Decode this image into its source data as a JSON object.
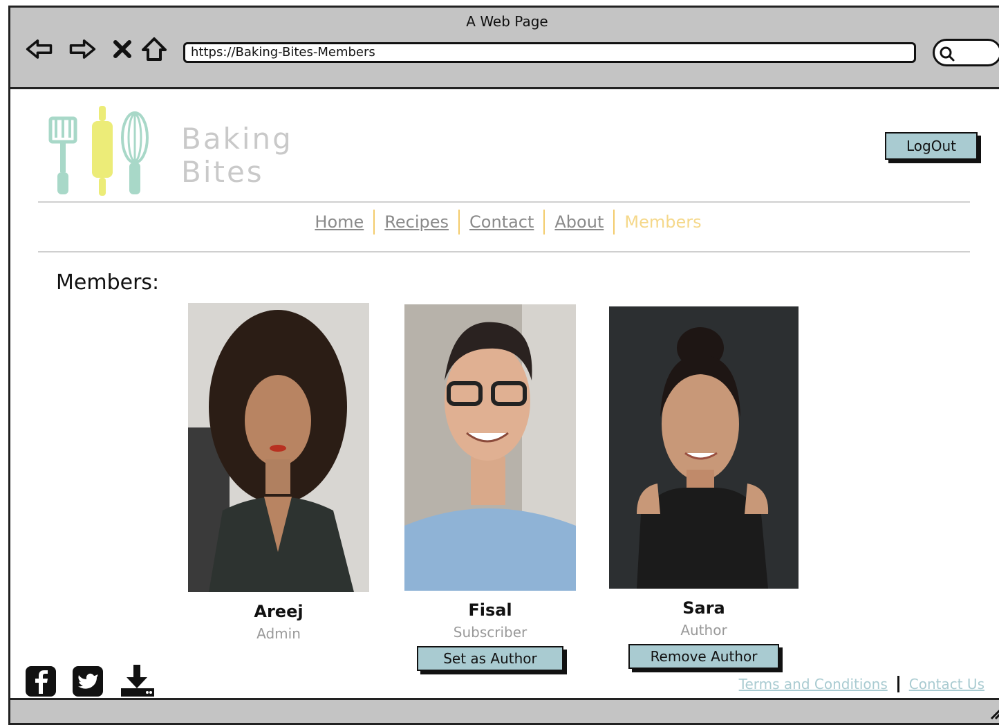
{
  "browser": {
    "title": "A Web Page",
    "url": "https://Baking-Bites-Members"
  },
  "header": {
    "logo_line1": "Baking",
    "logo_line2": "Bites",
    "logout_label": "LogOut"
  },
  "nav": [
    {
      "label": "Home"
    },
    {
      "label": "Recipes"
    },
    {
      "label": "Contact"
    },
    {
      "label": "About"
    },
    {
      "label": "Members"
    }
  ],
  "page_title": "Members:",
  "members": [
    {
      "name": "Areej",
      "role": "Admin"
    },
    {
      "name": "Fisal",
      "role": "Subscriber",
      "action": "Set as Author"
    },
    {
      "name": "Sara",
      "role": "Author",
      "action": "Remove Author"
    }
  ],
  "footer": {
    "links": [
      "Terms and Conditions",
      "Contact Us"
    ],
    "social_icons": [
      "facebook-icon",
      "twitter-icon",
      "download-icon"
    ]
  },
  "colors": {
    "button_bg": "#a9cbd1",
    "nav_active": "#f5d88a",
    "nav_divider": "#f3cb6a",
    "link": "#a9cbd1"
  }
}
